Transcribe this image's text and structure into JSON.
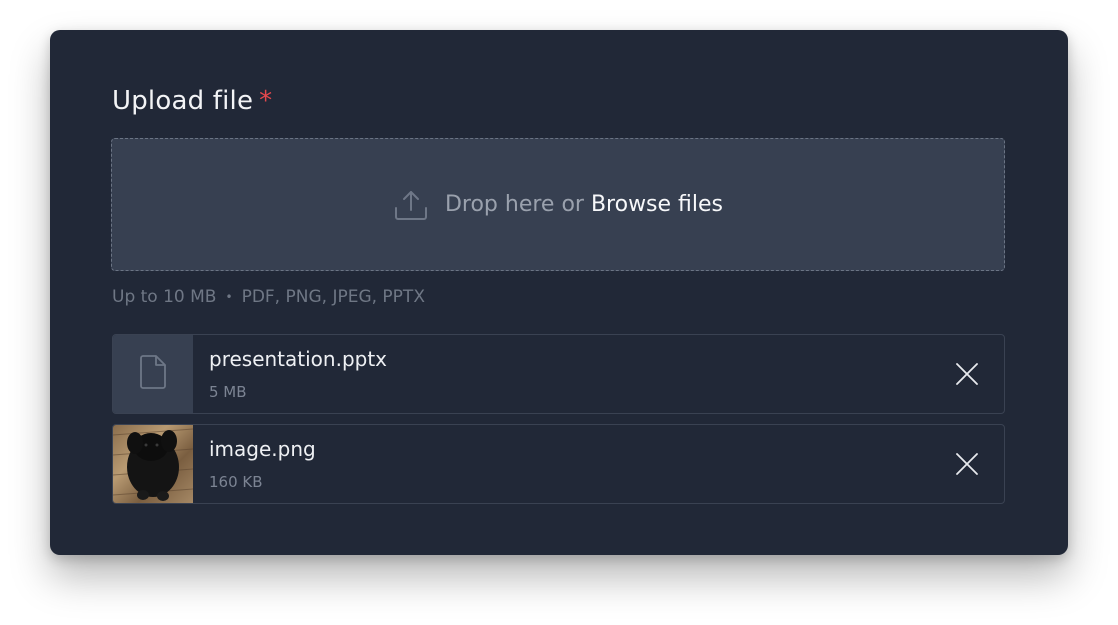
{
  "upload": {
    "title": "Upload file",
    "required_mark": "*"
  },
  "dropzone": {
    "prompt": "Drop here or",
    "browse_label": "Browse files",
    "icon": "upload-icon"
  },
  "hint": {
    "max_size": "Up to 10 MB",
    "separator": "•",
    "formats": "PDF, PNG, JPEG, PPTX"
  },
  "files": [
    {
      "name": "presentation.pptx",
      "size": "5 MB",
      "icon": "file-icon"
    },
    {
      "name": "image.png",
      "size": "160 KB",
      "icon": "image-thumbnail"
    }
  ],
  "colors": {
    "card_background": "#212837",
    "dropzone_background": "#374051",
    "required": "#e5484d",
    "text_primary": "#f3f4f6",
    "text_muted": "#6f7785"
  }
}
